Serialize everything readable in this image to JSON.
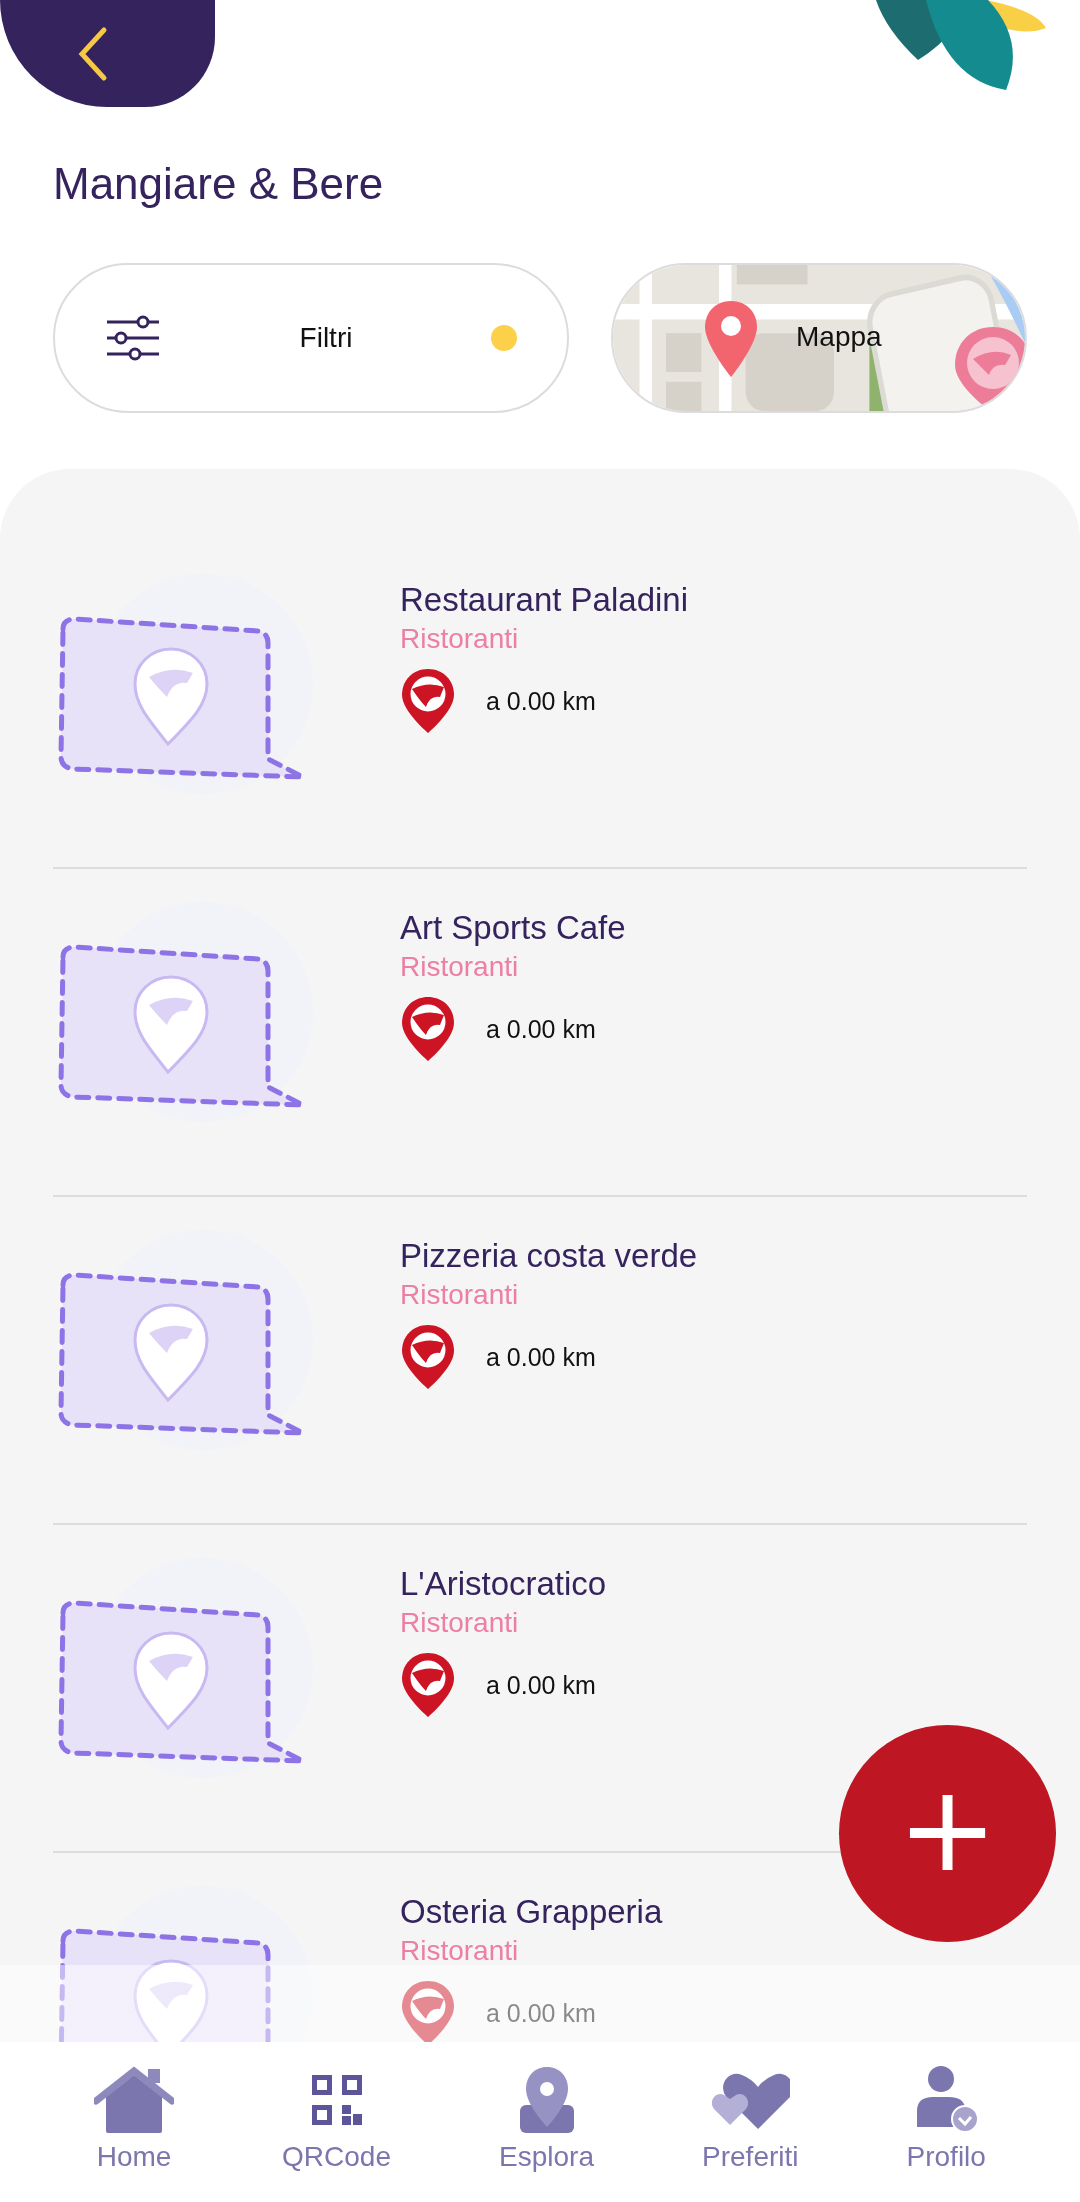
{
  "header": {
    "title": "Mangiare & Bere"
  },
  "filter_button": {
    "label": "Filtri",
    "active": true
  },
  "map_button": {
    "label": "Mappa"
  },
  "places": [
    {
      "name": "Restaurant Paladini",
      "category": "Ristoranti",
      "distance": "a 0.00 km"
    },
    {
      "name": "Art Sports Cafe",
      "category": "Ristoranti",
      "distance": "a 0.00 km"
    },
    {
      "name": "Pizzeria costa verde",
      "category": "Ristoranti",
      "distance": "a 0.00 km"
    },
    {
      "name": "L'Aristocratico",
      "category": "Ristoranti",
      "distance": "a 0.00 km"
    },
    {
      "name": "Osteria Grapperia",
      "category": "Ristoranti",
      "distance": "a 0.00 km"
    }
  ],
  "fab": {
    "label": "+"
  },
  "bottom_nav": [
    {
      "kind": "home",
      "label": "Home",
      "selected": false
    },
    {
      "kind": "qrcode",
      "label": "QRCode",
      "selected": false
    },
    {
      "kind": "explore",
      "label": "Esplora",
      "selected": false
    },
    {
      "kind": "favorites",
      "label": "Preferiti",
      "selected": false
    },
    {
      "kind": "profile",
      "label": "Profilo",
      "selected": false
    }
  ]
}
